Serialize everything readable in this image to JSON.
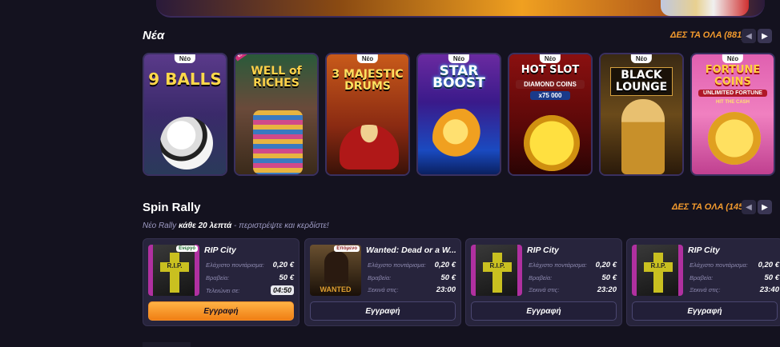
{
  "new_section": {
    "title": "Νέα",
    "see_all": "ΔΕΣ ΤΑ ΟΛΑ (881)",
    "games": [
      {
        "title": "9 BALLS",
        "badge": "Νέο",
        "palette": "purple"
      },
      {
        "title": "WELL of RICHES",
        "badge": "",
        "exclusive": "EXCLUSIVE",
        "palette": "green"
      },
      {
        "title": "3 MAJESTIC DRUMS",
        "badge": "Νέο",
        "palette": "orange"
      },
      {
        "title": "STAR BOOST",
        "badge": "Νέο",
        "palette": "blue"
      },
      {
        "title": "HOT SLOT",
        "subtitle": "DIAMOND COINS",
        "extra": "x75 000",
        "badge": "Νέο",
        "palette": "red"
      },
      {
        "title": "BLACK LOUNGE",
        "badge": "Νέο",
        "palette": "gold"
      },
      {
        "title": "FORTUNE COINS",
        "subtitle": "UNLIMITED FORTUNE",
        "extra": "HIT THE CASH",
        "badge": "Νέο",
        "palette": "pink"
      }
    ]
  },
  "spin_rally": {
    "title": "Spin Rally",
    "see_all": "ΔΕΣ ΤΑ ΟΛΑ (145)",
    "subtitle_prefix": "Νέο Rally",
    "subtitle_bold": "κάθε 20 λεπτά",
    "subtitle_suffix": "- περιστρέψτε και κερδίστε!",
    "cards": [
      {
        "name": "RIP City",
        "badge": "Ενεργό",
        "min_bet_label": "Ελάχιστο ποντάρισμα:",
        "min_bet": "0,20 €",
        "prizes_label": "Βραβεία:",
        "prizes": "50 €",
        "time_label": "Τελειώνει σε:",
        "time": "04:50",
        "button": "Εγγραφή",
        "primary": true
      },
      {
        "name": "Wanted: Dead or a W...",
        "badge": "Επόμενο",
        "min_bet_label": "Ελάχιστο ποντάρισμα:",
        "min_bet": "0,20 €",
        "prizes_label": "Βραβεία:",
        "prizes": "50 €",
        "time_label": "Ξεκινά στις:",
        "time": "23:00",
        "button": "Εγγραφή",
        "primary": false
      },
      {
        "name": "RIP City",
        "badge": "",
        "min_bet_label": "Ελάχιστο ποντάρισμα:",
        "min_bet": "0,20 €",
        "prizes_label": "Βραβεία:",
        "prizes": "50 €",
        "time_label": "Ξεκινά στις:",
        "time": "23:20",
        "button": "Εγγραφή",
        "primary": false
      },
      {
        "name": "RIP City",
        "badge": "",
        "min_bet_label": "Ελάχιστο ποντάρισμα:",
        "min_bet": "0,20 €",
        "prizes_label": "Βραβεία:",
        "prizes": "50 €",
        "time_label": "Ξεκινά στις:",
        "time": "23:40",
        "button": "Εγγραφή",
        "primary": false
      }
    ]
  },
  "icons": {
    "prev": "chevron-left-icon",
    "next": "chevron-right-icon"
  }
}
